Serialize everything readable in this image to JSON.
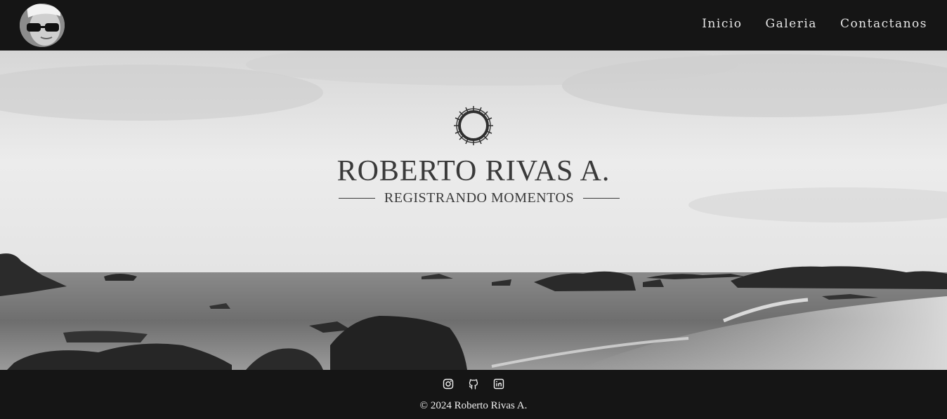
{
  "nav": {
    "items": [
      {
        "label": "Inicio"
      },
      {
        "label": "Galeria"
      },
      {
        "label": "Contactanos"
      }
    ]
  },
  "hero": {
    "title": "ROBERTO RIVAS A.",
    "subtitle": "REGISTRANDO MOMENTOS",
    "logo_icon": "crown-of-thorns-icon"
  },
  "footer": {
    "social_icons": [
      "instagram-icon",
      "github-icon",
      "linkedin-icon"
    ],
    "copyright": "© 2024 Roberto Rivas A."
  },
  "colors": {
    "bar_background": "#151515",
    "nav_text": "#e6e6e6",
    "brand_text": "#3a3a3a"
  }
}
